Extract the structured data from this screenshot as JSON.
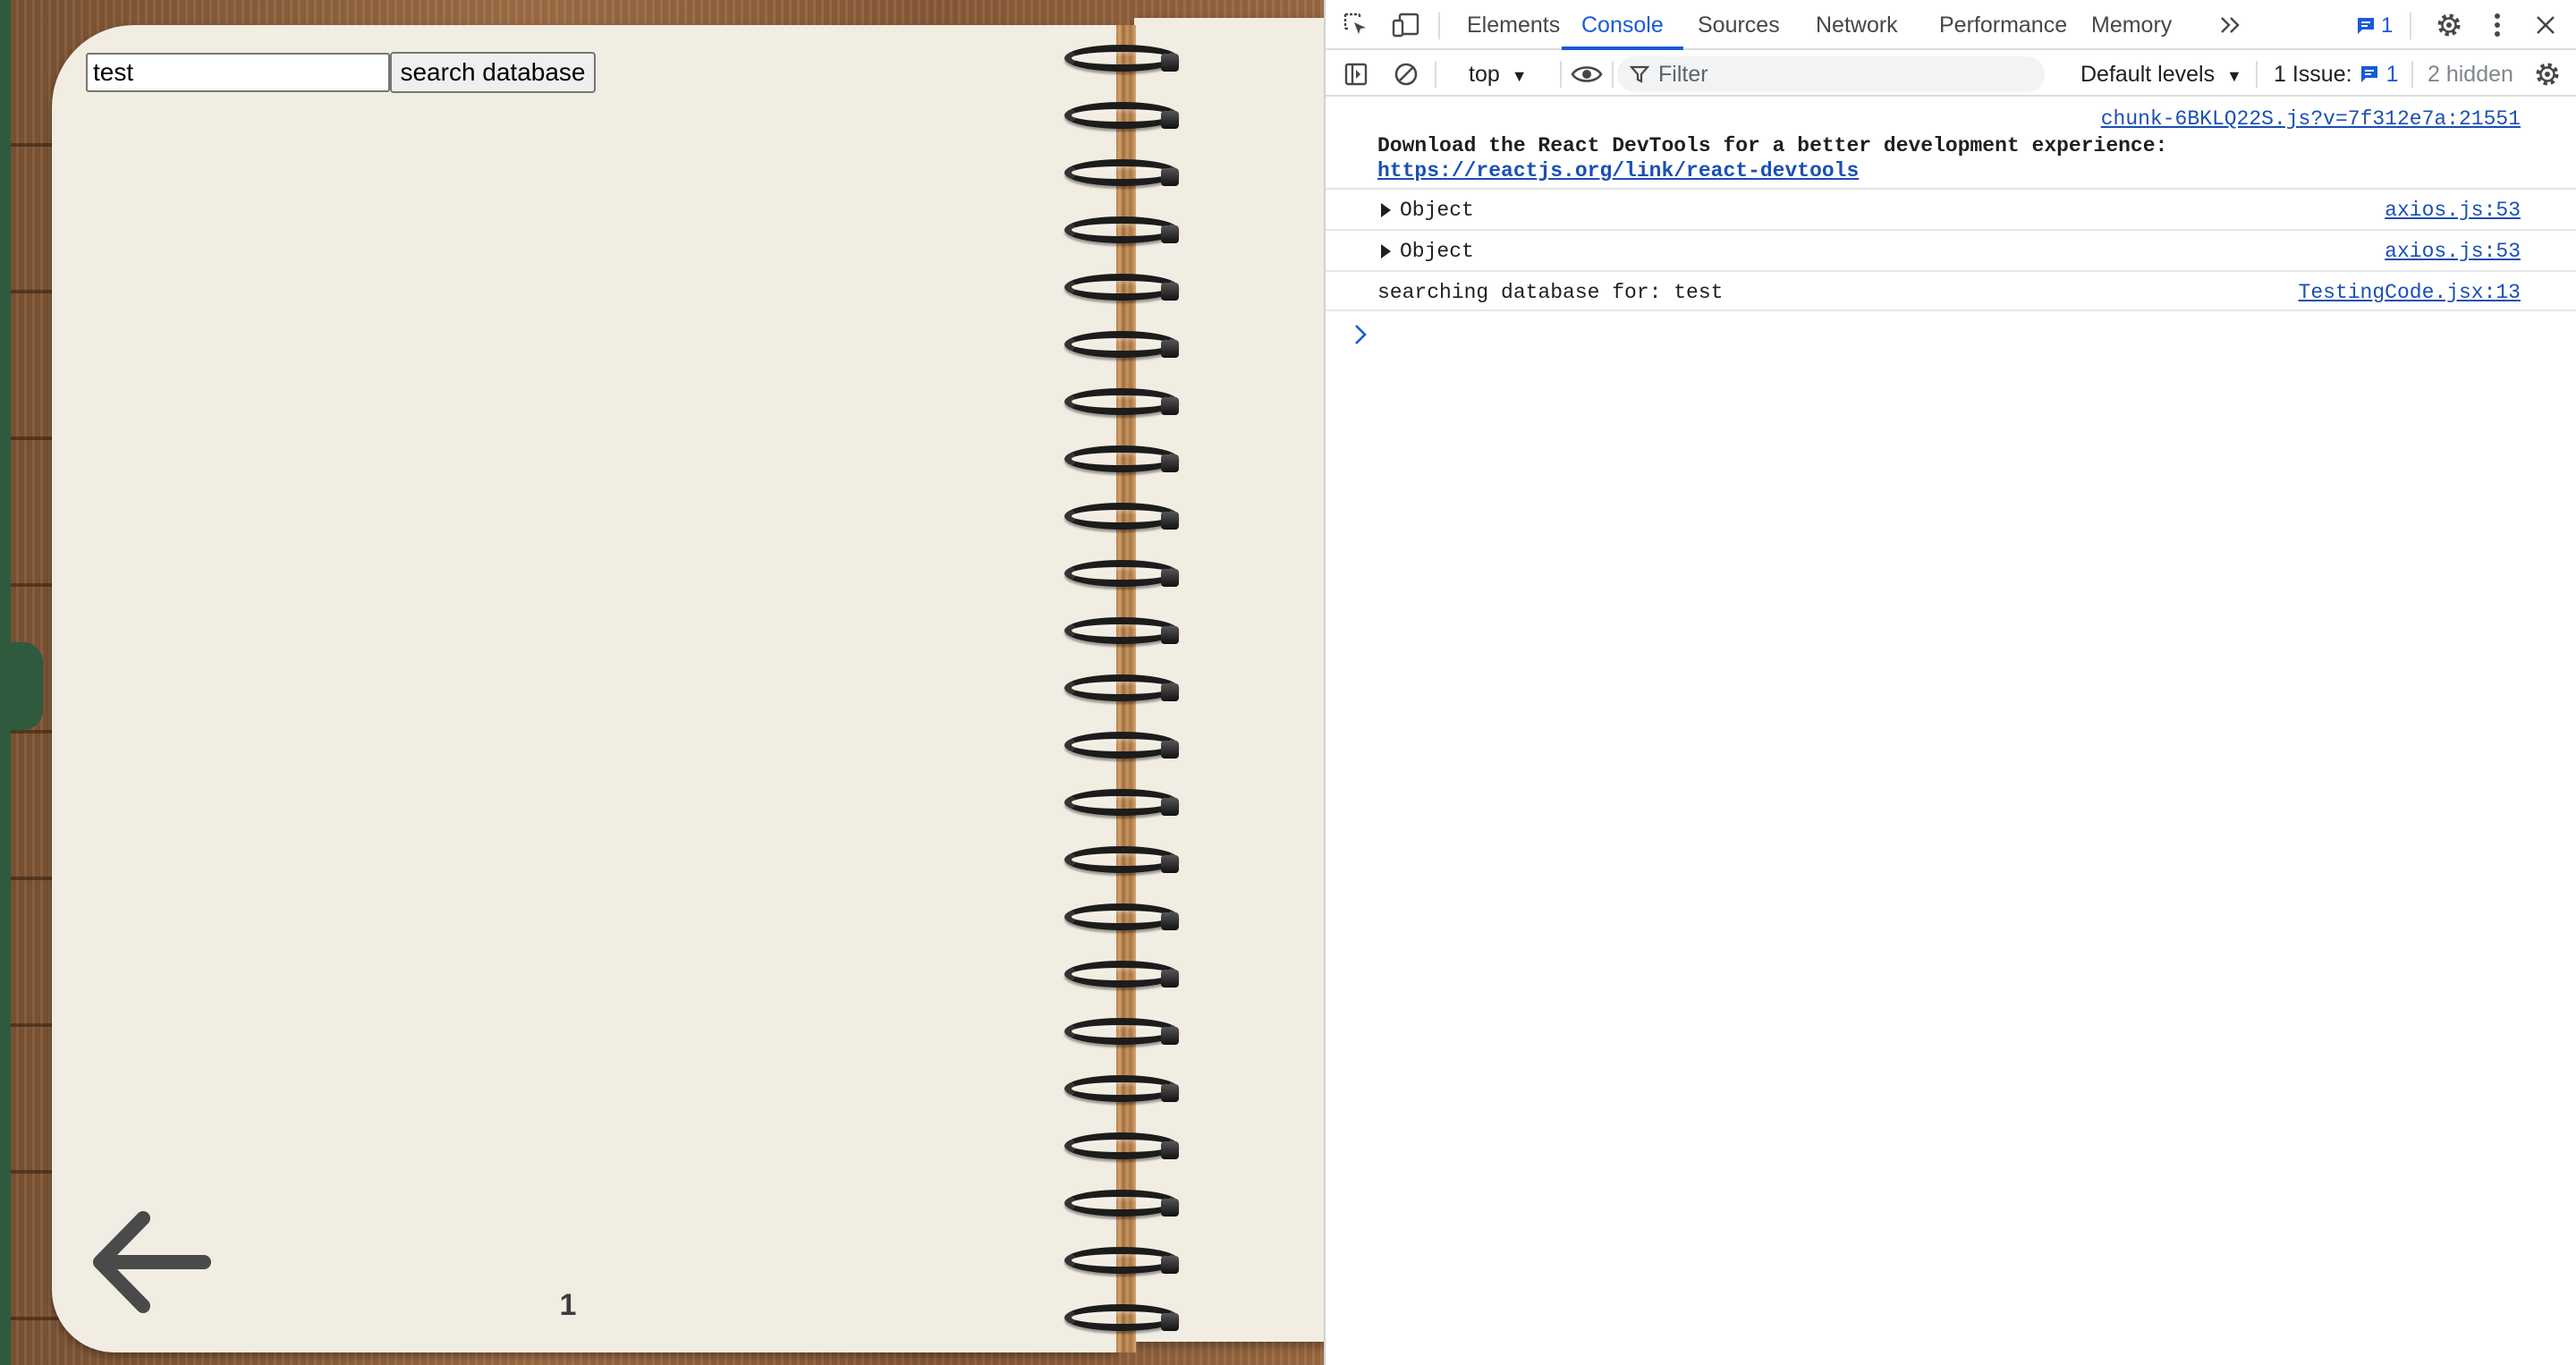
{
  "app": {
    "search": {
      "value": "test",
      "button_label": "search database"
    },
    "page_number": "1",
    "icons": {
      "back": "arrow-left-icon"
    },
    "colors": {
      "page": "#f2ede3",
      "cover": "#2f5a3d",
      "wood": "#8c5f3c"
    }
  },
  "devtools": {
    "tabs": [
      {
        "label": "Elements",
        "active": false
      },
      {
        "label": "Console",
        "active": true
      },
      {
        "label": "Sources",
        "active": false
      },
      {
        "label": "Network",
        "active": false
      },
      {
        "label": "Performance",
        "active": false
      },
      {
        "label": "Memory",
        "active": false
      }
    ],
    "issue_badge_count": "1",
    "context": "top",
    "filter_placeholder": "Filter",
    "levels": "Default levels",
    "issues_label": "1 Issue:",
    "issues_count": "1",
    "hidden": "2 hidden",
    "messages": [
      {
        "source": "chunk-6BKLQ22S.js?v=7f312e7a:21551",
        "text": "Download the React DevTools for a better development experience:",
        "link": "https://reactjs.org/link/react-devtools"
      },
      {
        "label": "Object",
        "source": "axios.js:53"
      },
      {
        "label": "Object",
        "source": "axios.js:53"
      },
      {
        "text": "searching database for: test",
        "source": "TestingCode.jsx:13"
      }
    ],
    "colors": {
      "accent": "#1a5ad8",
      "link": "#1a4fb5"
    }
  }
}
